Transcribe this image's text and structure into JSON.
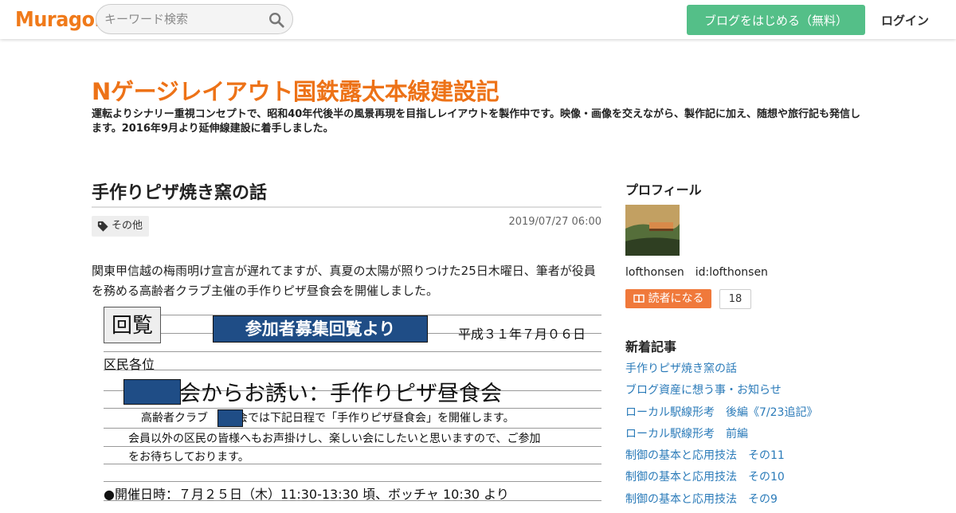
{
  "header": {
    "logo": "Muragon",
    "search_placeholder": "キーワード検索",
    "start_blog_label": "ブログをはじめる（無料）",
    "login_label": "ログイン"
  },
  "blog": {
    "title": "Nゲージレイアウト国鉄露太本線建設記",
    "description": "運転よりシナリー重視コンセプトで、昭和40年代後半の風景再現を目指しレイアウトを製作中です。映像・画像を交えながら、製作記に加え、随想や旅行記も発信します。2016年9月より延伸線建設に着手しました。"
  },
  "article": {
    "title": "手作りピザ焼き窯の話",
    "tag": "その他",
    "date": "2019/07/27 06:00",
    "body": "関東甲信越の梅雨明け宣言が遅れてますが、真夏の太陽が照りつけた25日木曜日、筆者が役員を務める高齢者クラブ主催の手作りピザ昼食会を開催しました。",
    "image": {
      "kanran": "回覧",
      "banner": "参加者募集回覧より",
      "date": "平成３１年７月０６日",
      "addressee": "区民各位",
      "invite_suffix": "会からお誘い：手作りピザ昼食会",
      "line1a": "高齢者クラブ",
      "line1b": "会では下記日程で「手作りピザ昼食会」を開催します。",
      "line2": "会員以外の区民の皆様へもお声掛けし、楽しい会にしたいと思いますので、ご参加",
      "line3": "をお待ちしております。",
      "line4": "●開催日時：７月２５日（木）11:30-13:30 頃、ボッチャ 10:30 より"
    }
  },
  "sidebar": {
    "profile_heading": "プロフィール",
    "profile_name": "lofthonsen　id:lofthonsen",
    "reader_button_label": "読者になる",
    "reader_count": "18",
    "recent_heading": "新着記事",
    "recent_items": [
      "手作りピザ焼き窯の話",
      "ブログ資産に想う事・お知らせ",
      "ローカル駅線形考　後編《7/23追記》",
      "ローカル駅線形考　前編",
      "制御の基本と応用技法　その11",
      "制御の基本と応用技法　その10",
      "制御の基本と応用技法　その9"
    ]
  },
  "colors": {
    "brand_orange": "#ed7217",
    "start_green": "#54bf88",
    "reader_orange": "#f0793b",
    "link_blue": "#2b7bb9"
  }
}
